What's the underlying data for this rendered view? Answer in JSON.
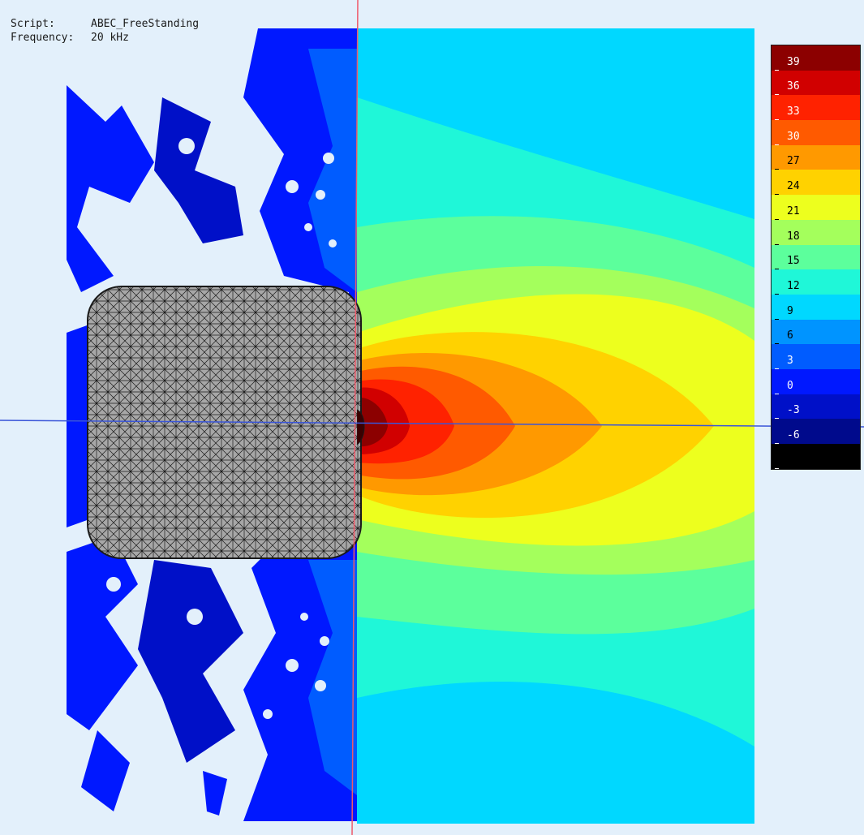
{
  "info": {
    "script_label": "Script:",
    "script_value": "ABEC_FreeStanding",
    "frequency_label": "Frequency:",
    "frequency_value": "20 kHz"
  },
  "legend": {
    "steps": [
      {
        "label": "39",
        "color": "#8c0000"
      },
      {
        "label": "36",
        "color": "#d10000"
      },
      {
        "label": "33",
        "color": "#ff2200"
      },
      {
        "label": "30",
        "color": "#ff5a00"
      },
      {
        "label": "27",
        "color": "#ff9900"
      },
      {
        "label": "24",
        "color": "#ffd200"
      },
      {
        "label": "21",
        "color": "#edff1e"
      },
      {
        "label": "18",
        "color": "#a4ff5c"
      },
      {
        "label": "15",
        "color": "#5cff9c"
      },
      {
        "label": "12",
        "color": "#1ff7d8"
      },
      {
        "label": "9",
        "color": "#00d8ff"
      },
      {
        "label": "6",
        "color": "#0094ff"
      },
      {
        "label": "3",
        "color": "#005cff"
      },
      {
        "label": "0",
        "color": "#0018ff"
      },
      {
        "label": "-3",
        "color": "#0010c8"
      },
      {
        "label": "-6",
        "color": "#000a8c"
      },
      {
        "label": "",
        "color": "#000000"
      }
    ]
  },
  "colors": {
    "background": "#e3f0fb",
    "crosshair_vertical": "#f05a6a",
    "crosshair_horizontal": "#3a55d8",
    "cabinet_fill": "#a6a6a6",
    "mesh_line": "#1a1a1a"
  }
}
